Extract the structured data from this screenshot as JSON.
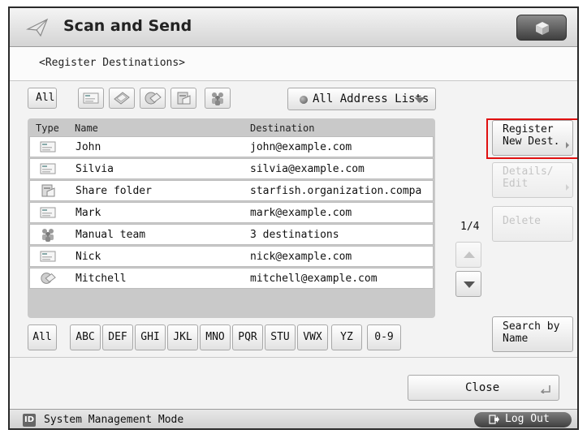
{
  "header": {
    "title": "Scan and Send"
  },
  "subheader": {
    "title": "<Register Destinations>"
  },
  "filters": {
    "all_label": "All",
    "types": [
      {
        "icon": "email-card-icon"
      },
      {
        "icon": "fax-icon"
      },
      {
        "icon": "ifax-icon"
      },
      {
        "icon": "file-server-icon"
      },
      {
        "icon": "group-icon"
      }
    ],
    "address_list": "All Address Lists"
  },
  "table": {
    "columns": {
      "type": "Type",
      "name": "Name",
      "destination": "Destination"
    },
    "rows": [
      {
        "icon": "email-card-icon",
        "name": "John",
        "destination": "john@example.com"
      },
      {
        "icon": "email-card-icon",
        "name": "Silvia",
        "destination": "silvia@example.com"
      },
      {
        "icon": "file-server-icon",
        "name": "Share folder",
        "destination": "starfish.organization.compa"
      },
      {
        "icon": "email-card-icon",
        "name": "Mark",
        "destination": "mark@example.com"
      },
      {
        "icon": "group-icon",
        "name": "Manual team",
        "destination": "3 destinations"
      },
      {
        "icon": "email-card-icon",
        "name": "Nick",
        "destination": "nick@example.com"
      },
      {
        "icon": "ifax-icon",
        "name": "Mitchell",
        "destination": "mitchell@example.com"
      }
    ]
  },
  "alphabet": [
    "All",
    "ABC",
    "DEF",
    "GHI",
    "JKL",
    "MNO",
    "PQR",
    "STU",
    "VWX",
    "YZ",
    "0-9"
  ],
  "side": {
    "register_l1": "Register",
    "register_l2": "New Dest.",
    "details_l1": "Details/",
    "details_l2": "Edit",
    "delete": "Delete",
    "page": "1/4",
    "search_l1": "Search by",
    "search_l2": "Name"
  },
  "close_label": "Close",
  "footer": {
    "id_badge": "ID",
    "mode": "System Management Mode",
    "logout": "Log Out"
  },
  "colors": {
    "highlight": "#e01010",
    "panel": "#c9c9c9"
  }
}
